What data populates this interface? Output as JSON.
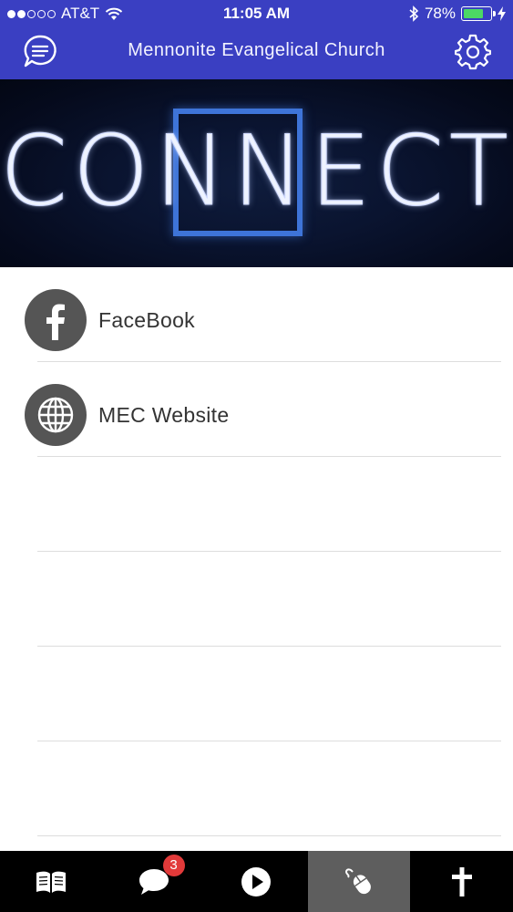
{
  "status_bar": {
    "carrier": "AT&T",
    "time": "11:05 AM",
    "battery_percent": "78%",
    "battery_level": 0.78,
    "signal_bars_filled": 2,
    "signal_bars_total": 5
  },
  "nav": {
    "title": "Mennonite Evangelical Church",
    "left_icon": "chat-menu-icon",
    "right_icon": "gear-icon"
  },
  "banner": {
    "word": "CONNECT"
  },
  "list": {
    "items": [
      {
        "label": "FaceBook",
        "icon": "facebook-icon"
      },
      {
        "label": "MEC Website",
        "icon": "globe-icon"
      }
    ]
  },
  "tabbar": {
    "tabs": [
      {
        "icon": "book-icon"
      },
      {
        "icon": "chat-bubble-icon",
        "badge": "3"
      },
      {
        "icon": "play-icon"
      },
      {
        "icon": "mouse-icon",
        "active": true
      },
      {
        "icon": "cross-icon"
      }
    ]
  },
  "colors": {
    "primary": "#3a3fc2",
    "tab_active": "#5e5e5e",
    "badge": "#e23a3a",
    "banner_frame": "#3e74d8"
  }
}
